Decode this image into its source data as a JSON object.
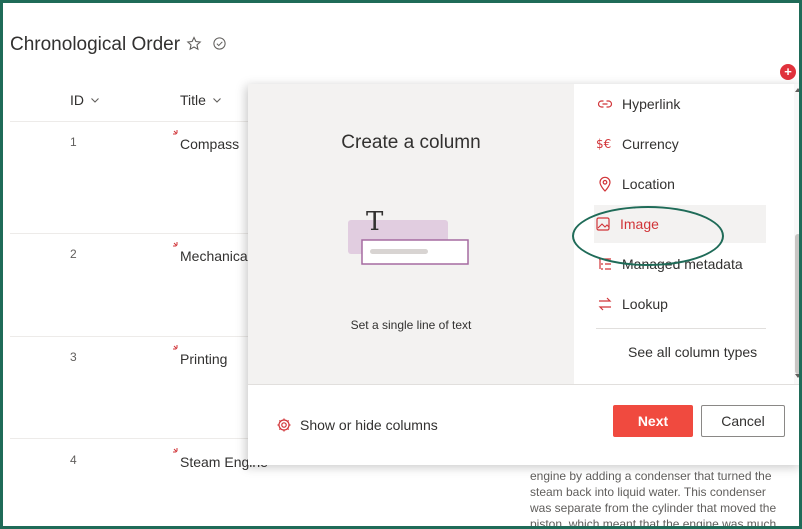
{
  "page": {
    "title": "Chronological Order"
  },
  "list": {
    "columns": {
      "id": "ID",
      "title": "Title"
    },
    "rows": [
      {
        "id": "1",
        "title": "Compass"
      },
      {
        "id": "2",
        "title": "Mechanical"
      },
      {
        "id": "3",
        "title": "Printing"
      },
      {
        "id": "4",
        "title": "Steam Engine"
      }
    ],
    "description_lines": [
      "engine by adding a condenser that turned the",
      "steam back into liquid water. This condenser",
      "was separate from the cylinder that moved the",
      "piston, which meant that the engine was much"
    ]
  },
  "panel": {
    "create_title": "Create a column",
    "illustration_glyph": "T",
    "caption": "Set a single line of text",
    "types": [
      {
        "label": "Hyperlink",
        "icon": "link-icon"
      },
      {
        "label": "Currency",
        "icon": "currency-icon"
      },
      {
        "label": "Location",
        "icon": "location-icon"
      },
      {
        "label": "Image",
        "icon": "image-icon",
        "selected": true
      },
      {
        "label": "Managed metadata",
        "icon": "tree-icon"
      },
      {
        "label": "Lookup",
        "icon": "lookup-icon"
      }
    ],
    "see_all": "See all column types",
    "show_hide": "Show or hide columns",
    "next": "Next",
    "cancel": "Cancel"
  },
  "colors": {
    "accent": "#f04a3f",
    "selected_text": "#d13438",
    "annotation": "#1f6b58"
  }
}
